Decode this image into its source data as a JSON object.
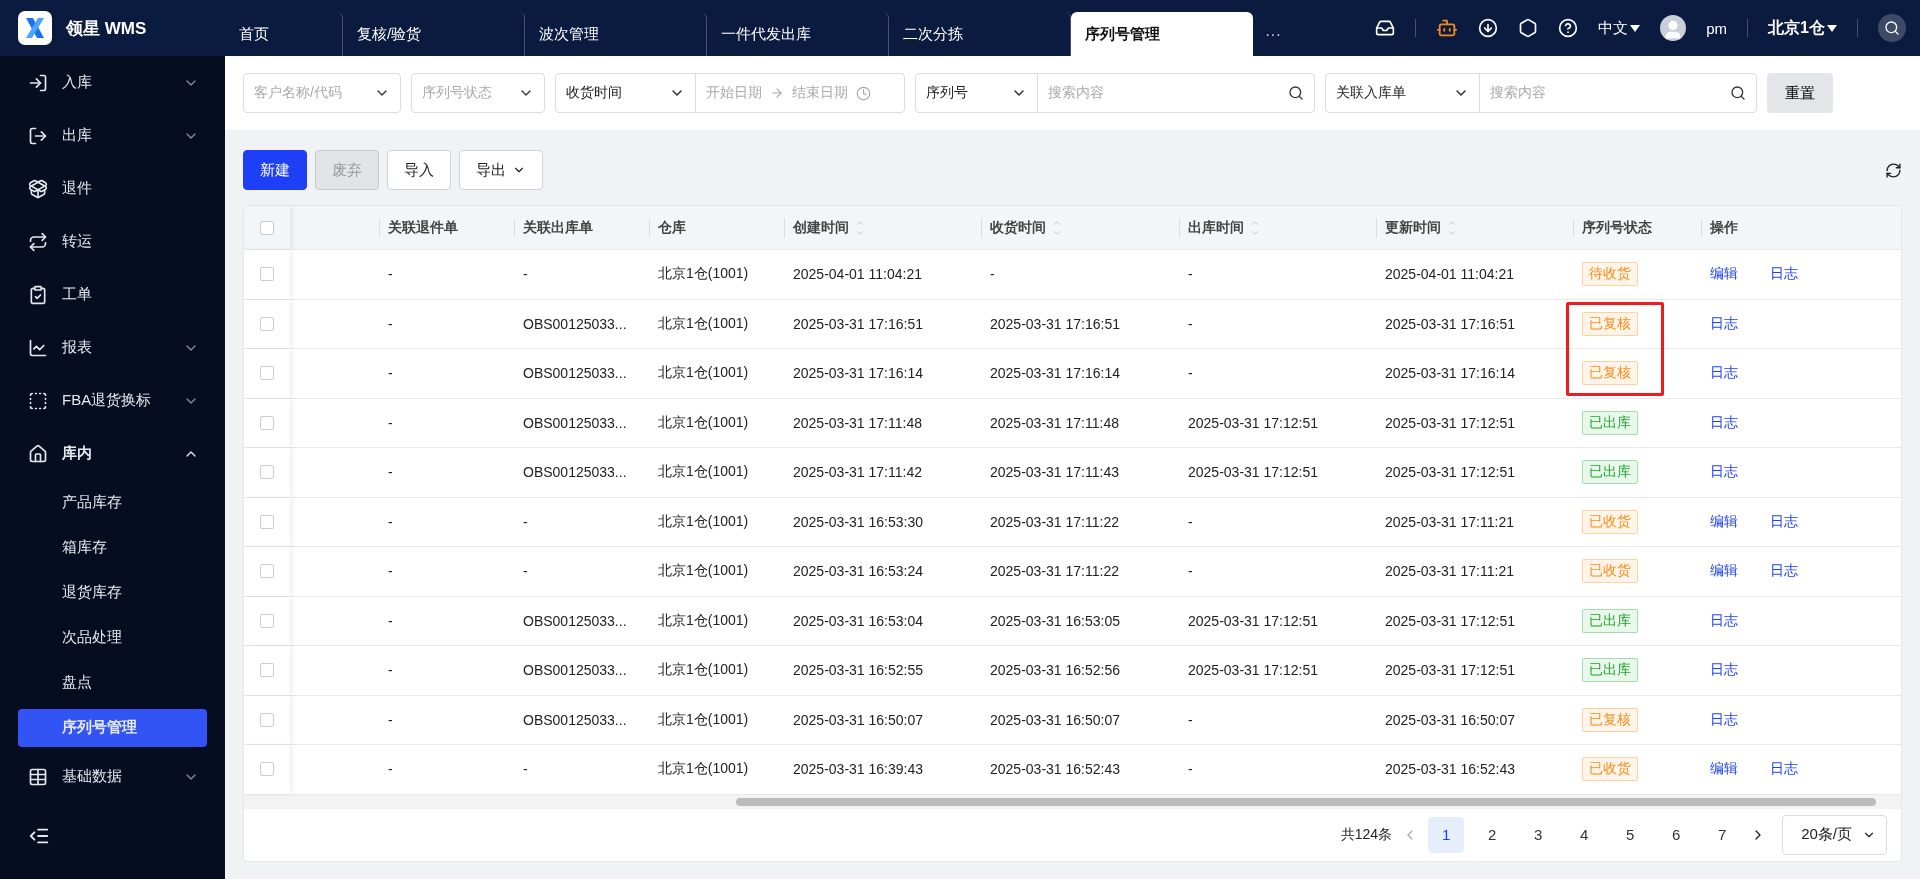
{
  "brand": {
    "name": "领星 WMS"
  },
  "tabs": [
    {
      "label": "首页",
      "selected": false
    },
    {
      "label": "复核/验货",
      "selected": false
    },
    {
      "label": "波次管理",
      "selected": false
    },
    {
      "label": "一件代发出库",
      "selected": false
    },
    {
      "label": "二次分拣",
      "selected": false
    },
    {
      "label": "序列号管理",
      "selected": true
    }
  ],
  "tabs_more": "···",
  "header": {
    "language": "中文",
    "user": "pm",
    "warehouse": "北京1仓"
  },
  "sidebar": {
    "items": [
      {
        "label": "入库",
        "expandable": true,
        "expanded": false
      },
      {
        "label": "出库",
        "expandable": true,
        "expanded": false
      },
      {
        "label": "退件",
        "expandable": false,
        "expanded": false
      },
      {
        "label": "转运",
        "expandable": false,
        "expanded": false
      },
      {
        "label": "工单",
        "expandable": false,
        "expanded": false
      },
      {
        "label": "报表",
        "expandable": true,
        "expanded": false
      },
      {
        "label": "FBA退货换标",
        "expandable": true,
        "expanded": false
      },
      {
        "label": "库内",
        "expandable": true,
        "expanded": true,
        "children": [
          {
            "label": "产品库存",
            "selected": false
          },
          {
            "label": "箱库存",
            "selected": false
          },
          {
            "label": "退货库存",
            "selected": false
          },
          {
            "label": "次品处理",
            "selected": false
          },
          {
            "label": "盘点",
            "selected": false
          },
          {
            "label": "序列号管理",
            "selected": true
          }
        ]
      },
      {
        "label": "基础数据",
        "expandable": true,
        "expanded": false
      }
    ]
  },
  "filters": {
    "customer": {
      "placeholder": "客户名称/代码"
    },
    "status": {
      "placeholder": "序列号状态"
    },
    "time_type": "收货时间",
    "start": {
      "placeholder": "开始日期"
    },
    "end": {
      "placeholder": "结束日期"
    },
    "search1": {
      "type": "序列号",
      "placeholder": "搜索内容"
    },
    "search2": {
      "type": "关联入库单",
      "placeholder": "搜索内容"
    },
    "reset": "重置"
  },
  "toolbar": [
    {
      "label": "新建",
      "kind": "primary"
    },
    {
      "label": "废弃",
      "kind": "disabled"
    },
    {
      "label": "导入",
      "kind": "default"
    },
    {
      "label": "导出",
      "kind": "dropdown"
    }
  ],
  "table": {
    "all_checked": false,
    "columns": [
      {
        "label": "关联退件单",
        "sortable": false
      },
      {
        "label": "关联出库单",
        "sortable": false
      },
      {
        "label": "仓库",
        "sortable": false
      },
      {
        "label": "创建时间",
        "sortable": true
      },
      {
        "label": "收货时间",
        "sortable": true
      },
      {
        "label": "出库时间",
        "sortable": true
      },
      {
        "label": "更新时间",
        "sortable": true
      },
      {
        "label": "序列号状态",
        "sortable": false
      },
      {
        "label": "操作",
        "sortable": false
      }
    ],
    "rows": [
      {
        "checked": false,
        "highlighted": false,
        "cells": [
          "-",
          "-",
          "北京1仓(1001)",
          "2025-04-01 11:04:21",
          "-",
          "-",
          "2025-04-01 11:04:21"
        ],
        "status": "待收货",
        "color": "#fa8c16",
        "actions": [
          "编辑",
          "日志"
        ]
      },
      {
        "checked": false,
        "highlighted": true,
        "cells": [
          "-",
          "OBS00125033...",
          "北京1仓(1001)",
          "2025-03-31 17:16:51",
          "2025-03-31 17:16:51",
          "-",
          "2025-03-31 17:16:51"
        ],
        "status": "已复核",
        "color": "#fa8c16",
        "actions": [
          "日志"
        ]
      },
      {
        "checked": false,
        "highlighted": true,
        "cells": [
          "-",
          "OBS00125033...",
          "北京1仓(1001)",
          "2025-03-31 17:16:14",
          "2025-03-31 17:16:14",
          "-",
          "2025-03-31 17:16:14"
        ],
        "status": "已复核",
        "color": "#fa8c16",
        "actions": [
          "日志"
        ]
      },
      {
        "checked": false,
        "highlighted": false,
        "cells": [
          "-",
          "OBS00125033...",
          "北京1仓(1001)",
          "2025-03-31 17:11:48",
          "2025-03-31 17:11:48",
          "2025-03-31 17:12:51",
          "2025-03-31 17:12:51"
        ],
        "status": "已出库",
        "color": "#1fa62e",
        "actions": [
          "日志"
        ]
      },
      {
        "checked": false,
        "highlighted": false,
        "cells": [
          "-",
          "OBS00125033...",
          "北京1仓(1001)",
          "2025-03-31 17:11:42",
          "2025-03-31 17:11:43",
          "2025-03-31 17:12:51",
          "2025-03-31 17:12:51"
        ],
        "status": "已出库",
        "color": "#1fa62e",
        "actions": [
          "日志"
        ]
      },
      {
        "checked": false,
        "highlighted": false,
        "cells": [
          "-",
          "-",
          "北京1仓(1001)",
          "2025-03-31 16:53:30",
          "2025-03-31 17:11:22",
          "-",
          "2025-03-31 17:11:21"
        ],
        "status": "已收货",
        "color": "#fa8c16",
        "actions": [
          "编辑",
          "日志"
        ]
      },
      {
        "checked": false,
        "highlighted": false,
        "cells": [
          "-",
          "-",
          "北京1仓(1001)",
          "2025-03-31 16:53:24",
          "2025-03-31 17:11:22",
          "-",
          "2025-03-31 17:11:21"
        ],
        "status": "已收货",
        "color": "#fa8c16",
        "actions": [
          "编辑",
          "日志"
        ]
      },
      {
        "checked": false,
        "highlighted": false,
        "cells": [
          "-",
          "OBS00125033...",
          "北京1仓(1001)",
          "2025-03-31 16:53:04",
          "2025-03-31 16:53:05",
          "2025-03-31 17:12:51",
          "2025-03-31 17:12:51"
        ],
        "status": "已出库",
        "color": "#1fa62e",
        "actions": [
          "日志"
        ]
      },
      {
        "checked": false,
        "highlighted": false,
        "cells": [
          "-",
          "OBS00125033...",
          "北京1仓(1001)",
          "2025-03-31 16:52:55",
          "2025-03-31 16:52:56",
          "2025-03-31 17:12:51",
          "2025-03-31 17:12:51"
        ],
        "status": "已出库",
        "color": "#1fa62e",
        "actions": [
          "日志"
        ]
      },
      {
        "checked": false,
        "highlighted": false,
        "cells": [
          "-",
          "OBS00125033...",
          "北京1仓(1001)",
          "2025-03-31 16:50:07",
          "2025-03-31 16:50:07",
          "-",
          "2025-03-31 16:50:07"
        ],
        "status": "已复核",
        "color": "#fa8c16",
        "actions": [
          "日志"
        ]
      },
      {
        "checked": false,
        "highlighted": false,
        "cells": [
          "-",
          "-",
          "北京1仓(1001)",
          "2025-03-31 16:39:43",
          "2025-03-31 16:52:43",
          "-",
          "2025-03-31 16:52:43"
        ],
        "status": "已收货",
        "color": "#fa8c16",
        "actions": [
          "编辑",
          "日志"
        ]
      }
    ]
  },
  "pagination": {
    "total": "共124条",
    "pages": [
      {
        "label": "1",
        "selected": true
      },
      {
        "label": "2",
        "selected": false
      },
      {
        "label": "3",
        "selected": false
      },
      {
        "label": "4",
        "selected": false
      },
      {
        "label": "5",
        "selected": false
      },
      {
        "label": "6",
        "selected": false
      },
      {
        "label": "7",
        "selected": false
      }
    ],
    "page_size": "20条/页"
  }
}
